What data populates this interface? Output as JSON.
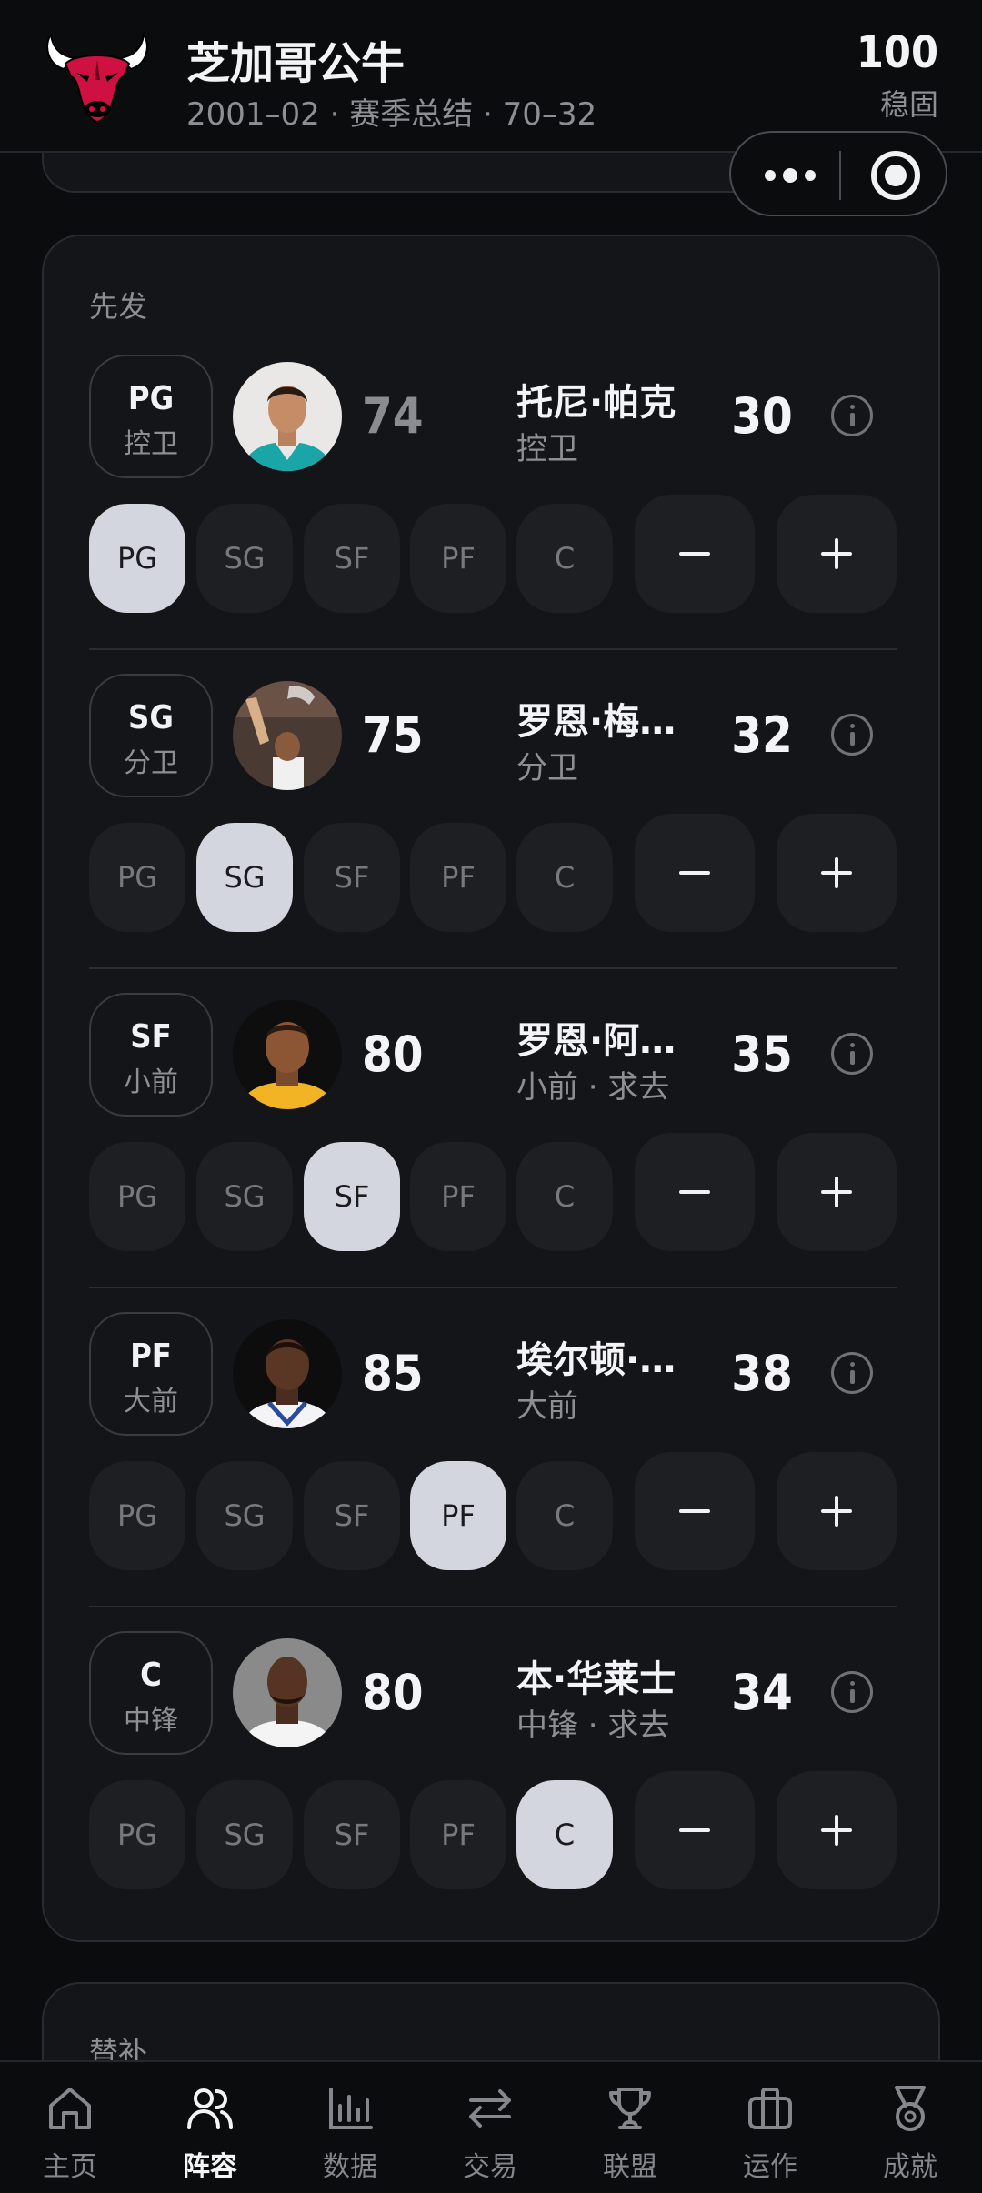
{
  "header": {
    "team_name": "芝加哥公牛",
    "subtitle": "2001–02 · 赛季总结 · 70–32",
    "stability_value": "100",
    "stability_label": "稳固",
    "brand_color": "#ce1141"
  },
  "starters": {
    "title": "先发",
    "players": [
      {
        "pos": "PG",
        "pos_cn": "控卫",
        "ovr": "74",
        "ovr_dim": true,
        "name": "托尼·帕克",
        "sub": "控卫",
        "age": "30",
        "active": "PG"
      },
      {
        "pos": "SG",
        "pos_cn": "分卫",
        "ovr": "75",
        "ovr_dim": false,
        "name": "罗恩·梅…",
        "sub": "分卫",
        "age": "32",
        "active": "SG"
      },
      {
        "pos": "SF",
        "pos_cn": "小前",
        "ovr": "80",
        "ovr_dim": false,
        "name": "罗恩·阿…",
        "sub": "小前 · 求去",
        "age": "35",
        "active": "SF"
      },
      {
        "pos": "PF",
        "pos_cn": "大前",
        "ovr": "85",
        "ovr_dim": false,
        "name": "埃尔顿·…",
        "sub": "大前",
        "age": "38",
        "active": "PF"
      },
      {
        "pos": "C",
        "pos_cn": "中锋",
        "ovr": "80",
        "ovr_dim": false,
        "name": "本·华莱士",
        "sub": "中锋 · 求去",
        "age": "34",
        "active": "C"
      }
    ],
    "position_options": [
      "PG",
      "SG",
      "SF",
      "PF",
      "C"
    ],
    "minus_label": "−",
    "plus_label": "+"
  },
  "bench": {
    "title": "替补"
  },
  "nav": {
    "items": [
      {
        "label": "主页",
        "icon": "home-icon"
      },
      {
        "label": "阵容",
        "icon": "roster-icon",
        "active": true
      },
      {
        "label": "数据",
        "icon": "stats-icon"
      },
      {
        "label": "交易",
        "icon": "trade-icon"
      },
      {
        "label": "联盟",
        "icon": "trophy-icon"
      },
      {
        "label": "运作",
        "icon": "briefcase-icon"
      },
      {
        "label": "成就",
        "icon": "medal-icon"
      }
    ]
  }
}
